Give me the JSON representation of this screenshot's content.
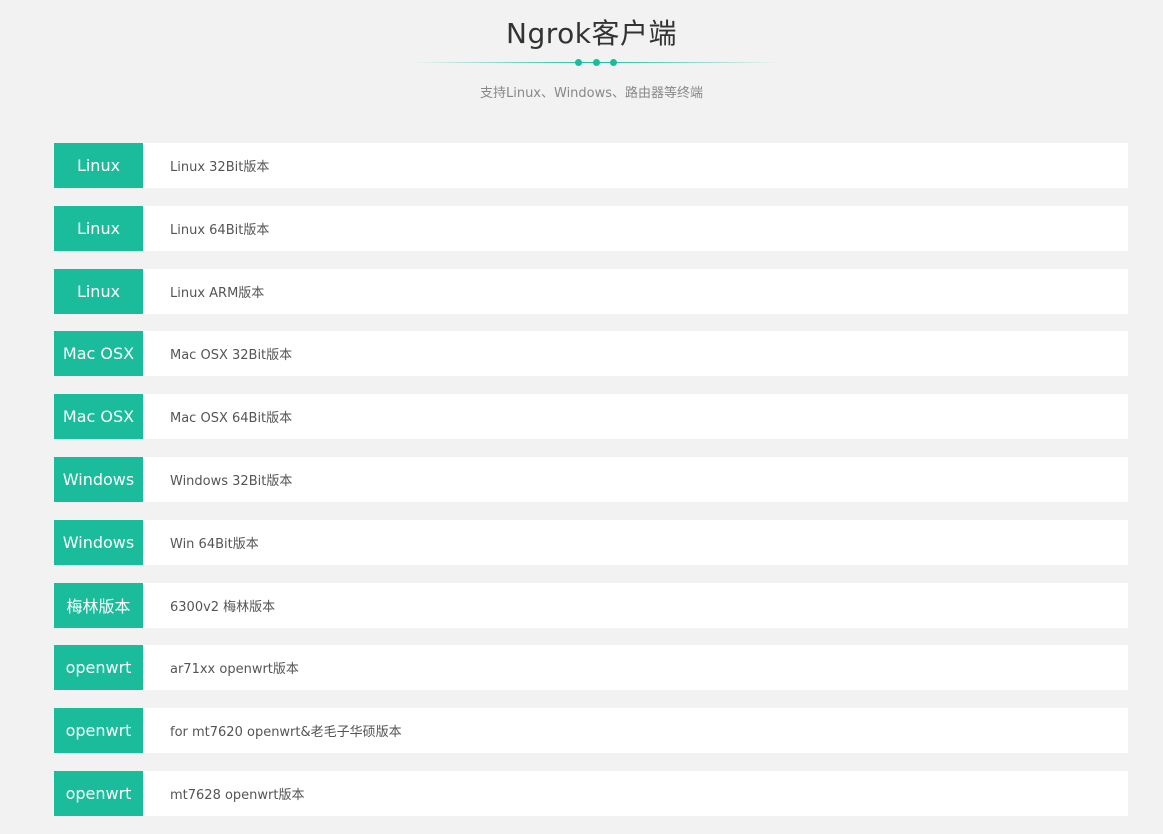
{
  "header": {
    "title": "Ngrok客户端",
    "subtitle": "支持Linux、Windows、路由器等终端"
  },
  "colors": {
    "accent": "#1abc9c",
    "background": "#f2f2f2",
    "row_background": "#ffffff"
  },
  "downloads": [
    {
      "platform": "Linux",
      "description": "Linux 32Bit版本"
    },
    {
      "platform": "Linux",
      "description": "Linux 64Bit版本"
    },
    {
      "platform": "Linux",
      "description": "Linux ARM版本"
    },
    {
      "platform": "Mac OSX",
      "description": "Mac OSX 32Bit版本"
    },
    {
      "platform": "Mac OSX",
      "description": "Mac OSX 64Bit版本"
    },
    {
      "platform": "Windows",
      "description": "Windows 32Bit版本"
    },
    {
      "platform": "Windows",
      "description": "Win 64Bit版本"
    },
    {
      "platform": "梅林版本",
      "description": "6300v2 梅林版本"
    },
    {
      "platform": "openwrt",
      "description": "ar71xx openwrt版本"
    },
    {
      "platform": "openwrt",
      "description": "for mt7620 openwrt&老毛子华硕版本"
    },
    {
      "platform": "openwrt",
      "description": "mt7628 openwrt版本"
    }
  ]
}
